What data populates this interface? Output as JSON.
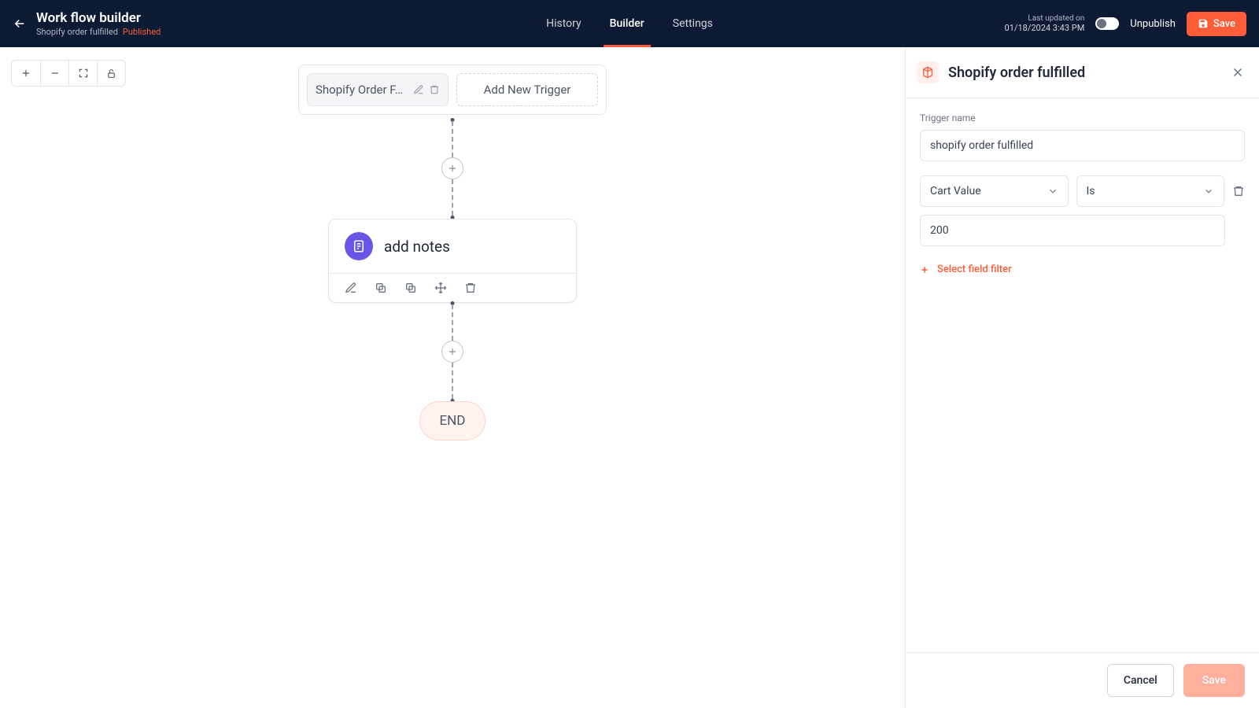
{
  "header": {
    "title": "Work flow builder",
    "subtitle": "Shopify order fulfilled",
    "status": "Published",
    "tabs": {
      "history": "History",
      "builder": "Builder",
      "settings": "Settings"
    },
    "last_updated_label": "Last updated on",
    "last_updated_date": "01/18/2024 3:43 PM",
    "toggle_label": "Unpublish",
    "save": "Save"
  },
  "canvas": {
    "trigger_label": "Shopify Order F…",
    "add_trigger": "Add New Trigger",
    "node_title": "add notes",
    "end": "END"
  },
  "panel": {
    "title": "Shopify order fulfilled",
    "trigger_name_label": "Trigger name",
    "trigger_name_value": "shopify order fulfilled",
    "filter_field": "Cart Value",
    "filter_op": "Is",
    "filter_value": "200",
    "add_filter": "Select field filter",
    "cancel": "Cancel",
    "save": "Save"
  }
}
